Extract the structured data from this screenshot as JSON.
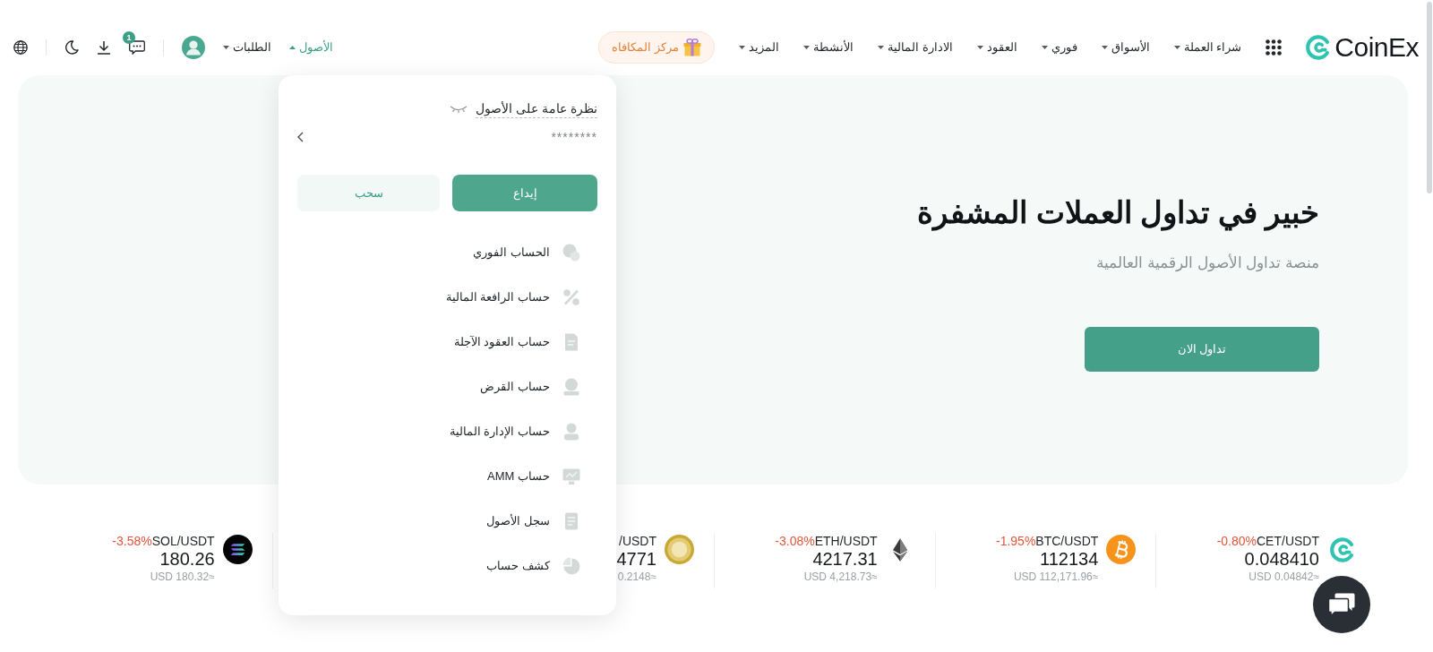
{
  "header": {
    "logo": "CoinEx",
    "nav": [
      {
        "label": "شراء العملة",
        "expanded": false
      },
      {
        "label": "الأسواق",
        "expanded": false
      },
      {
        "label": "فوري",
        "expanded": false
      },
      {
        "label": "العقود",
        "expanded": false
      },
      {
        "label": "الادارة المالية",
        "expanded": false
      },
      {
        "label": "الأنشطة",
        "expanded": false
      },
      {
        "label": "المزيد",
        "expanded": false
      }
    ],
    "reward_button": "مركز المكافاه",
    "account_menu": [
      {
        "label": "الأصول",
        "expanded": true
      },
      {
        "label": "الطلبات",
        "expanded": false
      }
    ],
    "messages_badge": "1"
  },
  "hero": {
    "title": "خبير في تداول العملات المشفرة",
    "subtitle": "منصة تداول الأصول الرقمية العالمية",
    "button": "تداول الان"
  },
  "assets_dropdown": {
    "title": "نظرة عامة على الأصول",
    "balance": "********",
    "buttons": [
      {
        "label": "إيداع",
        "kind": "primary"
      },
      {
        "label": "سحب",
        "kind": "secondary"
      }
    ],
    "items": [
      {
        "label": "الحساب الفوري",
        "kind": "spot"
      },
      {
        "label": "حساب الرافعة المالية",
        "kind": "margin"
      },
      {
        "label": "حساب العقود الآجلة",
        "kind": "futures"
      },
      {
        "label": "حساب القرض",
        "kind": "loan"
      },
      {
        "label": "حساب الإدارة المالية",
        "kind": "finance"
      },
      {
        "label": "حساب AMM",
        "kind": "amm"
      },
      {
        "label": "سجل الأصول",
        "kind": "history"
      },
      {
        "label": "كشف حساب",
        "kind": "statement"
      }
    ]
  },
  "ticker": [
    {
      "kind": "cet",
      "pair": "CET/USDT",
      "change": "-0.80%",
      "price": "0.048410",
      "usd": "USD 0.04842≈"
    },
    {
      "kind": "btc",
      "pair": "BTC/USDT",
      "change": "-1.95%",
      "price": "112134",
      "usd": "USD 112,171.96≈"
    },
    {
      "kind": "eth",
      "pair": "ETH/USDT",
      "change": "-3.08%",
      "price": "4217.31",
      "usd": "USD 4,218.73≈"
    },
    {
      "kind": "doge",
      "pair": "/USDT",
      "price": "4771",
      "usd": "0.2148≈"
    },
    {
      "kind": "sol",
      "pair": "SOL/USDT",
      "change": "-3.58%",
      "price": "180.26",
      "usd": "USD 180.32≈"
    }
  ]
}
